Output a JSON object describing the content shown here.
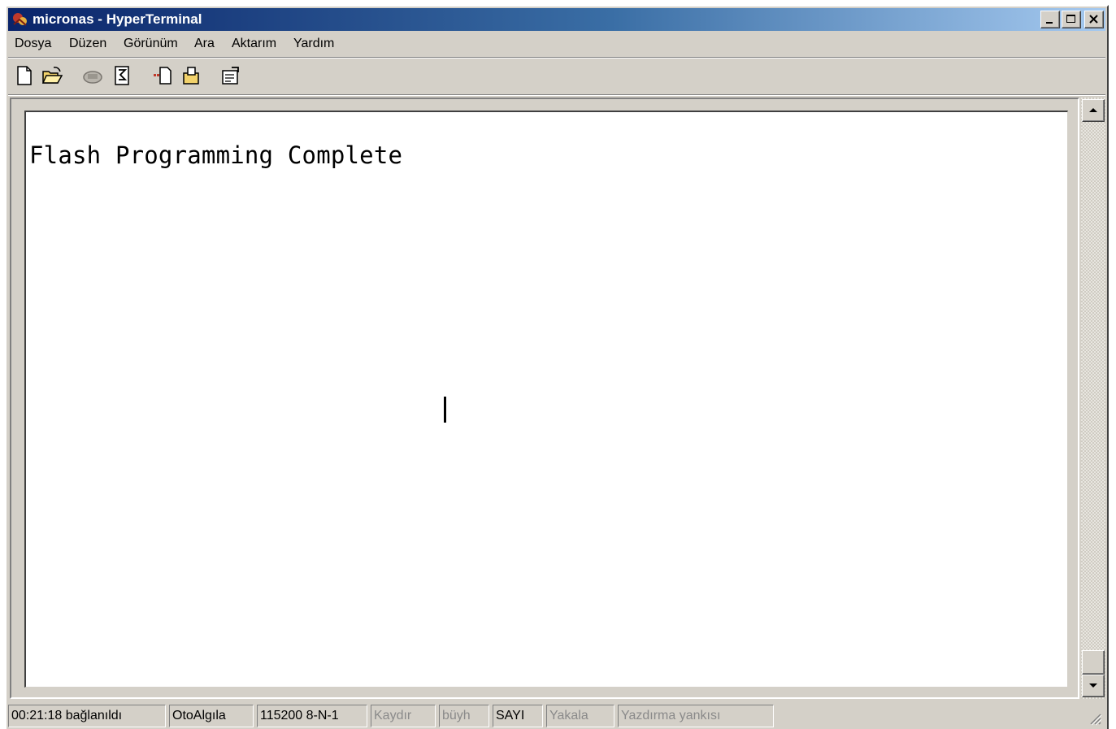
{
  "window": {
    "title": "micronas - HyperTerminal",
    "colors": {
      "titlebar_start": "#0a246a",
      "titlebar_end": "#a6caf0",
      "face": "#d4d0c8"
    }
  },
  "menu": {
    "items": [
      "Dosya",
      "Düzen",
      "Görünüm",
      "Ara",
      "Aktarım",
      "Yardım"
    ]
  },
  "toolbar": {
    "icons": [
      "new-document-icon",
      "open-folder-icon",
      "connect-phone-icon",
      "disconnect-phone-icon",
      "send-file-icon",
      "receive-file-icon",
      "properties-icon"
    ]
  },
  "terminal": {
    "lines": [
      "Flash Programming Complete"
    ]
  },
  "status": {
    "connected": "00:21:18 bağlanıldı",
    "detect": "OtoAlgıla",
    "settings": "115200 8-N-1",
    "scroll": "Kaydır",
    "caps": "büyh",
    "num": "SAYI",
    "capture": "Yakala",
    "print_echo": "Yazdırma yankısı"
  }
}
